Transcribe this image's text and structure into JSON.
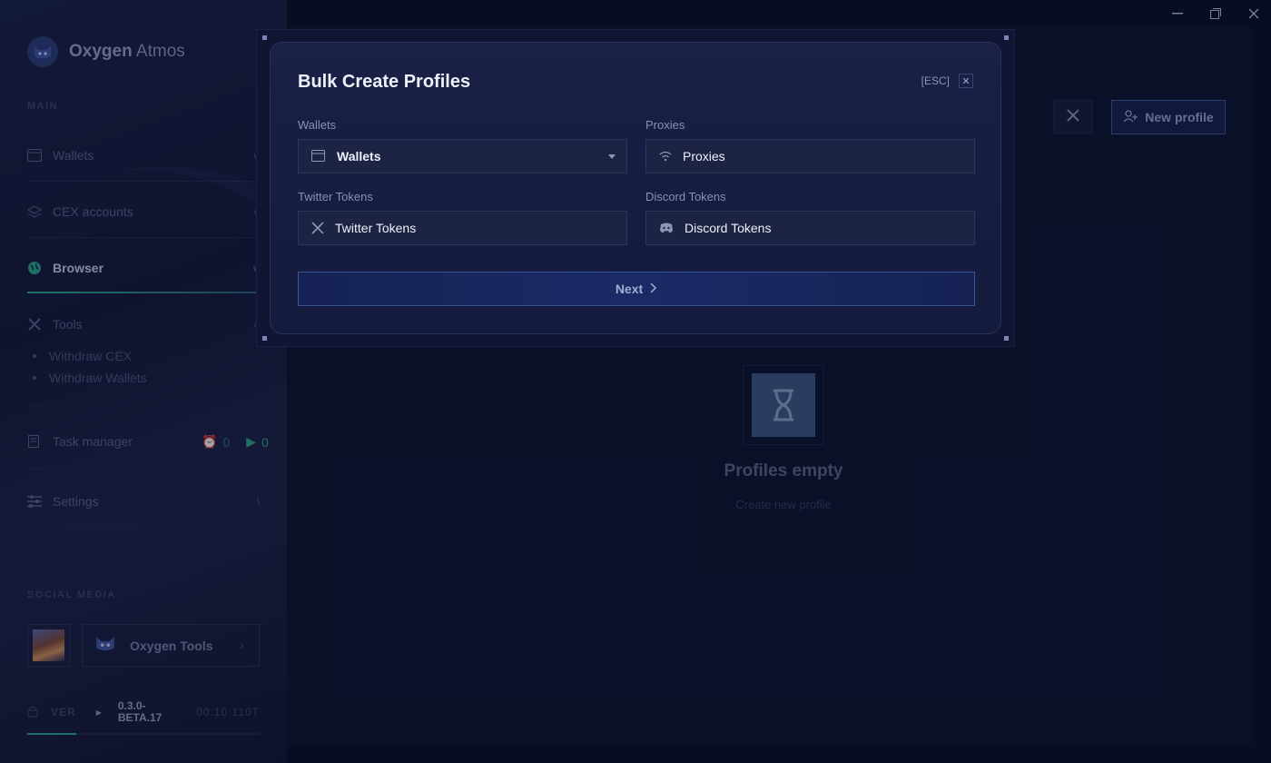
{
  "app": {
    "name_bold": "Oxygen",
    "name_light": " Atmos"
  },
  "sidebar": {
    "main_section": "MAIN",
    "items": [
      {
        "label": "Wallets",
        "icon": "wallet-icon"
      },
      {
        "label": "CEX accounts",
        "icon": "layers-icon"
      },
      {
        "label": "Browser",
        "icon": "globe-icon",
        "active": true
      },
      {
        "label": "Tools",
        "icon": "tools-icon"
      },
      {
        "label": "Task manager",
        "icon": "task-icon"
      },
      {
        "label": "Settings",
        "icon": "sliders-icon"
      }
    ],
    "tools_sub": [
      "Withdraw CEX",
      "Withdraw Wallets"
    ],
    "task_counts": {
      "scheduled": "0",
      "running": "0"
    },
    "social_section": "SOCIAL MEDIA",
    "social_card": "Oxygen Tools",
    "version_label": "VER",
    "version_value": "0.3.0-BETA.17",
    "version_time": "00:10:110T"
  },
  "main": {
    "new_profile": "New profile",
    "empty_title": "Profiles empty",
    "empty_sub": "Create new profile"
  },
  "modal": {
    "title": "Bulk Create Profiles",
    "esc": "[ESC]",
    "close_glyph": "✕",
    "fields": {
      "wallets_label": "Wallets",
      "wallets_value": "Wallets",
      "proxies_label": "Proxies",
      "proxies_value": "Proxies",
      "twitter_label": "Twitter Tokens",
      "twitter_value": "Twitter Tokens",
      "discord_label": "Discord Tokens",
      "discord_value": "Discord Tokens"
    },
    "next": "Next"
  },
  "colors": {
    "accent_green": "#2da88a",
    "accent_blue": "#3d5a9a",
    "background": "#0b1026"
  }
}
